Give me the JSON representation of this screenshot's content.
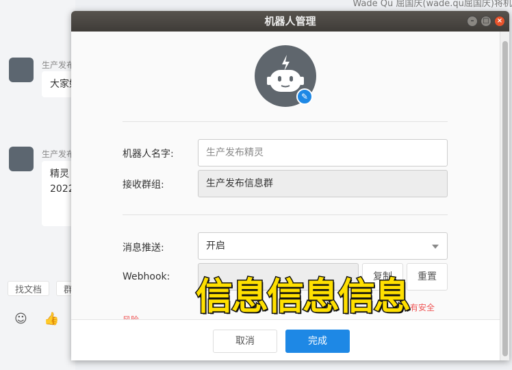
{
  "top_info": "Wade Qu 屈国庆(wade.qu屈国庆)将机",
  "chat": {
    "messages": [
      {
        "sender": "生产发布",
        "text": "大家好"
      },
      {
        "sender": "生产发布",
        "text": "精灵",
        "text2": "2022"
      }
    ],
    "chips": [
      "找文档",
      "群"
    ]
  },
  "dialog": {
    "title": "机器人管理",
    "fields": {
      "name_label": "机器人名字:",
      "name_value": "生产发布精灵",
      "group_label": "接收群组:",
      "group_value": "生产发布信息群",
      "push_label": "消息推送:",
      "push_value": "开启",
      "webhook_label": "Webhook:",
      "copy_label": "复制",
      "reset_label": "重置",
      "warning": "有安全",
      "warning2": "风险"
    },
    "cancel": "取消",
    "done": "完成"
  },
  "overlay": "信息信息信息",
  "colors": {
    "primary": "#1e88e5",
    "titlebar": "#4a4743"
  }
}
